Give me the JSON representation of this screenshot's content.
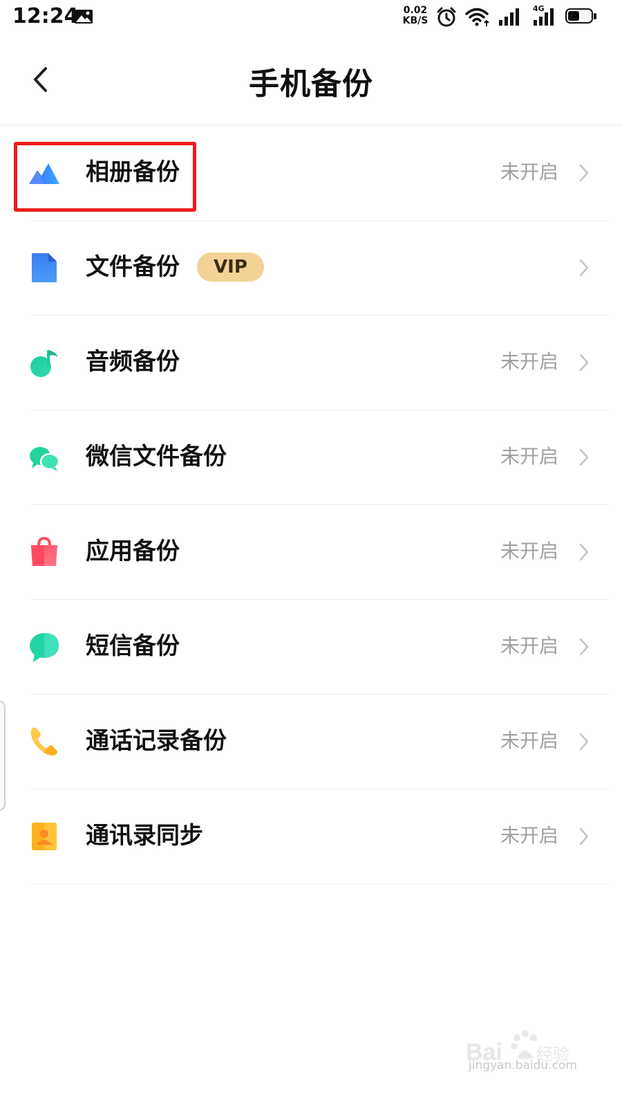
{
  "status_bar": {
    "time": "12:24",
    "net_speed_value": "0.02",
    "net_speed_unit": "KB/S",
    "network_type": "4G",
    "battery": "43",
    "icons": [
      "photo-notification-icon",
      "alarm-icon",
      "wifi-icon",
      "signal-icon",
      "signal-4g-icon",
      "battery-icon"
    ]
  },
  "header": {
    "title": "手机备份",
    "back_icon": "chevron-left-icon"
  },
  "items": [
    {
      "label": "相册备份",
      "status": "未开启",
      "icon": "photo-album-icon",
      "color": "#3d7bff",
      "highlighted": true
    },
    {
      "label": "文件备份",
      "status": "",
      "badge": "VIP",
      "icon": "file-icon",
      "color": "#3f8cf4"
    },
    {
      "label": "音频备份",
      "status": "未开启",
      "icon": "music-note-icon",
      "color": "#27d3a0"
    },
    {
      "label": "微信文件备份",
      "status": "未开启",
      "icon": "wechat-icon",
      "color": "#25d39a"
    },
    {
      "label": "应用备份",
      "status": "未开启",
      "icon": "shopping-bag-icon",
      "color": "#ff5a6e"
    },
    {
      "label": "短信备份",
      "status": "未开启",
      "icon": "message-bubble-icon",
      "color": "#22d4a3"
    },
    {
      "label": "通话记录备份",
      "status": "未开启",
      "icon": "phone-icon",
      "color": "#ffb020"
    },
    {
      "label": "通讯录同步",
      "status": "未开启",
      "icon": "contact-card-icon",
      "color": "#ffc53a"
    }
  ],
  "colors": {
    "highlight_box": "#ee1c1c",
    "vip_badge_bg": "#f2d395",
    "status_text": "#a0a0a0"
  },
  "watermark": {
    "brand": "Bai du 经验",
    "url": "jingyan.baidu.com"
  }
}
